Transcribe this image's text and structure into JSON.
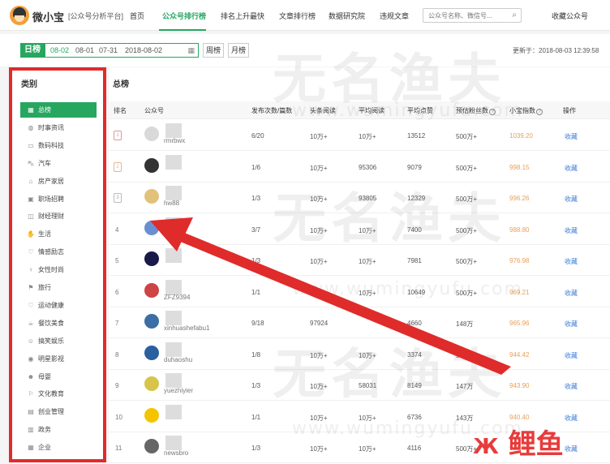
{
  "header": {
    "logo_text": "微小宝",
    "logo_sub": "[公众号分析平台]",
    "nav": [
      "首页",
      "公众号排行榜",
      "排名上升最快",
      "文章排行榜",
      "数据研究院",
      "违规文章"
    ],
    "search_placeholder": "公众号名称、微信号...",
    "fav_label": "收藏公众号"
  },
  "datebar": {
    "day_label": "日榜",
    "dates": [
      "08-02",
      "08-01",
      "07-31",
      "2018-08-02"
    ],
    "week_label": "周榜",
    "month_label": "月榜",
    "updated": "更新于：2018-08-03 12:39:58"
  },
  "sidebar": {
    "title": "类别",
    "categories": [
      {
        "label": "总榜",
        "icon": "grid-icon",
        "glyph": "▦"
      },
      {
        "label": "时事资讯",
        "icon": "globe-icon",
        "glyph": "◍"
      },
      {
        "label": "数码科技",
        "icon": "monitor-icon",
        "glyph": "▭"
      },
      {
        "label": "汽车",
        "icon": "car-icon",
        "glyph": "⛍"
      },
      {
        "label": "房产家居",
        "icon": "house-icon",
        "glyph": "⌂"
      },
      {
        "label": "职场招聘",
        "icon": "briefcase-icon",
        "glyph": "▣"
      },
      {
        "label": "财经理财",
        "icon": "wallet-icon",
        "glyph": "◫"
      },
      {
        "label": "生活",
        "icon": "hand-icon",
        "glyph": "✋"
      },
      {
        "label": "情感励志",
        "icon": "heart-icon",
        "glyph": "♡"
      },
      {
        "label": "女性时尚",
        "icon": "female-icon",
        "glyph": "♀"
      },
      {
        "label": "旅行",
        "icon": "flag-icon",
        "glyph": "⚑"
      },
      {
        "label": "运动健康",
        "icon": "heartbeat-icon",
        "glyph": "♡"
      },
      {
        "label": "餐饮美食",
        "icon": "coffee-icon",
        "glyph": "☕"
      },
      {
        "label": "搞笑娱乐",
        "icon": "smile-icon",
        "glyph": "☺"
      },
      {
        "label": "明星影视",
        "icon": "film-icon",
        "glyph": "◉"
      },
      {
        "label": "母婴",
        "icon": "baby-icon",
        "glyph": "☻"
      },
      {
        "label": "文化教育",
        "icon": "graduation-icon",
        "glyph": "⚐"
      },
      {
        "label": "创业管理",
        "icon": "chart-icon",
        "glyph": "▤"
      },
      {
        "label": "政务",
        "icon": "building-icon",
        "glyph": "▥"
      },
      {
        "label": "企业",
        "icon": "office-icon",
        "glyph": "▦"
      }
    ]
  },
  "main": {
    "title": "总榜",
    "columns": [
      "排名",
      "公众号",
      "发布次数/篇数",
      "头条阅读",
      "平均阅读",
      "平均点赞",
      "预估粉丝数",
      "小宝指数",
      "操作"
    ],
    "rows": [
      {
        "rank": "1",
        "account": "rmrbwx",
        "posts": "6/20",
        "headline": "10万+",
        "avg_read": "10万+",
        "avg_like": "13512",
        "fans": "500万+",
        "index": "1039.20",
        "op": "收藏"
      },
      {
        "rank": "2",
        "account": "",
        "posts": "1/6",
        "headline": "10万+",
        "avg_read": "95306",
        "avg_like": "9079",
        "fans": "500万+",
        "index": "998.15",
        "op": "收藏"
      },
      {
        "rank": "3",
        "account": "hw88",
        "posts": "1/3",
        "headline": "10万+",
        "avg_read": "93805",
        "avg_like": "12329",
        "fans": "500万+",
        "index": "996.26",
        "op": "收藏"
      },
      {
        "rank": "4",
        "account": "",
        "posts": "3/7",
        "headline": "10万+",
        "avg_read": "10万+",
        "avg_like": "7400",
        "fans": "500万+",
        "index": "988.80",
        "op": "收藏"
      },
      {
        "rank": "5",
        "account": "",
        "posts": "1/3",
        "headline": "10万+",
        "avg_read": "10万+",
        "avg_like": "7981",
        "fans": "500万+",
        "index": "976.98",
        "op": "收藏"
      },
      {
        "rank": "6",
        "account": "ZFZ9394",
        "posts": "1/1",
        "headline": "10万+",
        "avg_read": "10万+",
        "avg_like": "10649",
        "fans": "500万+",
        "index": "969.21",
        "op": "收藏"
      },
      {
        "rank": "7",
        "account": "xinhuashefabu1",
        "posts": "9/18",
        "headline": "97924",
        "avg_read": "",
        "avg_like": "4660",
        "fans": "148万",
        "index": "965.96",
        "op": "收藏"
      },
      {
        "rank": "8",
        "account": "duhaoshu",
        "posts": "1/8",
        "headline": "10万+",
        "avg_read": "10万+",
        "avg_like": "3374",
        "fans": "500万+",
        "index": "944.42",
        "op": "收藏"
      },
      {
        "rank": "9",
        "account": "yuezhiyier",
        "posts": "1/3",
        "headline": "10万+",
        "avg_read": "58031",
        "avg_like": "8149",
        "fans": "147万",
        "index": "943.90",
        "op": "收藏"
      },
      {
        "rank": "10",
        "account": "",
        "posts": "1/1",
        "headline": "10万+",
        "avg_read": "10万+",
        "avg_like": "6736",
        "fans": "143万",
        "index": "940.40",
        "op": "收藏"
      },
      {
        "rank": "11",
        "account": "newsbro",
        "posts": "1/3",
        "headline": "10万+",
        "avg_read": "10万+",
        "avg_like": "4116",
        "fans": "500万+",
        "index": "938.51",
        "op": "收藏"
      }
    ]
  },
  "overlay": {
    "watermark_cn": "无名渔夫",
    "watermark_url": "www.wumingyufu.com",
    "brand": "鲤鱼",
    "colors": {
      "accent": "#27a660",
      "arrow": "#e02b2b",
      "index": "#e9a055",
      "link": "#3d7dd8"
    }
  }
}
